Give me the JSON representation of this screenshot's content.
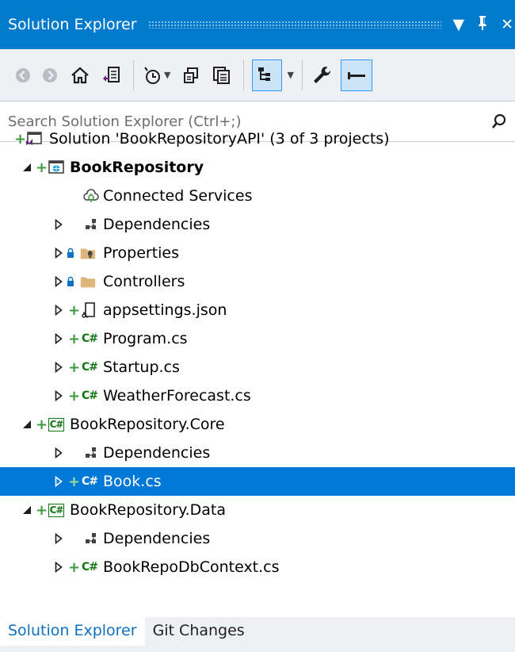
{
  "window": {
    "title": "Solution Explorer",
    "controls": [
      "▼",
      "P",
      "✕"
    ]
  },
  "toolbar": {
    "buttons": [
      "back-icon",
      "forward-icon",
      "home-icon",
      "switch-views-icon",
      "pending-changes-filter-icon",
      "sync-with-active-document-icon",
      "collapse-all-icon",
      "show-all-files-icon",
      "preview-selected-items-icon",
      "properties-icon",
      "preview-pane-icon"
    ]
  },
  "search": {
    "placeholder": "Search Solution Explorer (Ctrl+;)"
  },
  "tree": {
    "solution": "Solution 'BookRepositoryAPI' (3 of 3 projects)",
    "project1": {
      "name": "BookRepository",
      "items": [
        "Connected Services",
        "Dependencies",
        "Properties",
        "Controllers",
        "appsettings.json",
        "Program.cs",
        "Startup.cs",
        "WeatherForecast.cs"
      ]
    },
    "project2": {
      "name": "BookRepository.Core",
      "items": [
        "Dependencies",
        "Book.cs"
      ]
    },
    "project3": {
      "name": "BookRepository.Data",
      "items": [
        "Dependencies",
        "BookRepoDbContext.cs"
      ]
    },
    "cs_glyph": "C#"
  },
  "tabs": [
    "Solution Explorer",
    "Git Changes"
  ],
  "colors": {
    "titlebar": "#007acc",
    "selection": "#0078d7",
    "add_sign": "#3c9a3c",
    "folder": "#dcb67a"
  }
}
